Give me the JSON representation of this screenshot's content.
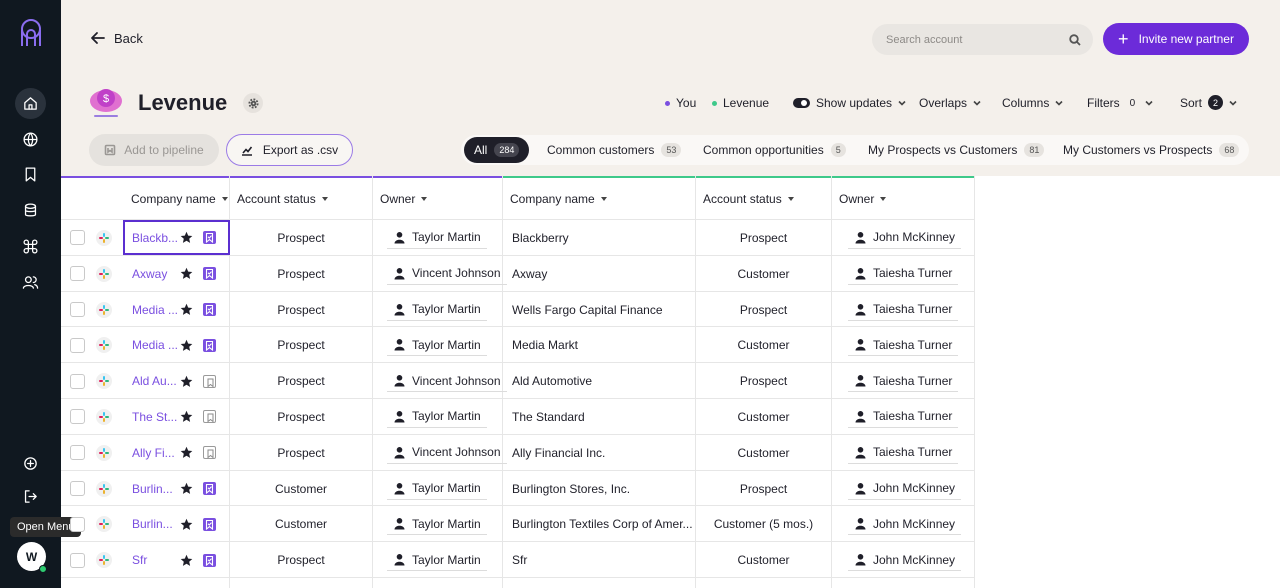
{
  "rail": {
    "tooltip": "Open Menu",
    "avatar_initial": "W"
  },
  "header": {
    "back_label": "Back",
    "search_placeholder": "Search account",
    "invite_label": "Invite new partner",
    "title": "Levenue",
    "legend": [
      {
        "label": "You",
        "color": "#7a4fe0"
      },
      {
        "label": "Levenue",
        "color": "#3ec98a"
      }
    ],
    "controls": {
      "show_updates": "Show updates",
      "overlaps": "Overlaps",
      "columns": "Columns",
      "filters": "Filters",
      "filters_count": "0",
      "sort": "Sort",
      "sort_count": "2"
    },
    "add_pipeline_label": "Add to pipeline",
    "export_label": "Export as .csv",
    "tabs": [
      {
        "label": "All",
        "count": "284"
      },
      {
        "label": "Common customers",
        "count": "53"
      },
      {
        "label": "Common opportunities",
        "count": "5"
      },
      {
        "label": "My Prospects vs Customers",
        "count": "81"
      },
      {
        "label": "My Customers vs Prospects",
        "count": "68"
      }
    ]
  },
  "table": {
    "headers": {
      "company": "Company name",
      "status": "Account status",
      "owner": "Owner",
      "p_company": "Company name",
      "p_status": "Account status",
      "p_owner": "Owner"
    },
    "rows": [
      {
        "company": "Blackb...",
        "bookmarked": true,
        "status": "Prospect",
        "owner": "Taylor Martin",
        "p_company": "Blackberry",
        "p_status": "Prospect",
        "p_owner": "John McKinney"
      },
      {
        "company": "Axway",
        "bookmarked": true,
        "status": "Prospect",
        "owner": "Vincent Johnson",
        "p_company": "Axway",
        "p_status": "Customer",
        "p_owner": "Taiesha Turner"
      },
      {
        "company": "Media ...",
        "bookmarked": true,
        "status": "Prospect",
        "owner": "Taylor Martin",
        "p_company": "Wells Fargo Capital Finance",
        "p_status": "Prospect",
        "p_owner": "Taiesha Turner"
      },
      {
        "company": "Media ...",
        "bookmarked": true,
        "status": "Prospect",
        "owner": "Taylor Martin",
        "p_company": "Media Markt",
        "p_status": "Customer",
        "p_owner": "Taiesha Turner"
      },
      {
        "company": "Ald Au...",
        "bookmarked": false,
        "status": "Prospect",
        "owner": "Vincent Johnson",
        "p_company": "Ald Automotive",
        "p_status": "Prospect",
        "p_owner": "Taiesha Turner"
      },
      {
        "company": "The St...",
        "bookmarked": false,
        "status": "Prospect",
        "owner": "Taylor Martin",
        "p_company": "The Standard",
        "p_status": "Customer",
        "p_owner": "Taiesha Turner"
      },
      {
        "company": "Ally Fi...",
        "bookmarked": false,
        "status": "Prospect",
        "owner": "Vincent Johnson",
        "p_company": "Ally Financial Inc.",
        "p_status": "Customer",
        "p_owner": "Taiesha Turner"
      },
      {
        "company": "Burlin...",
        "bookmarked": true,
        "status": "Customer",
        "owner": "Taylor Martin",
        "p_company": "Burlington Stores, Inc.",
        "p_status": "Prospect",
        "p_owner": "John McKinney"
      },
      {
        "company": "Burlin...",
        "bookmarked": true,
        "status": "Customer",
        "owner": "Taylor Martin",
        "p_company": "Burlington Textiles Corp of Amer...",
        "p_status": "Customer (5 mos.)",
        "p_owner": "John McKinney"
      },
      {
        "company": "Sfr",
        "bookmarked": true,
        "status": "Prospect",
        "owner": "Taylor Martin",
        "p_company": "Sfr",
        "p_status": "Customer",
        "p_owner": "John McKinney"
      }
    ]
  },
  "colors": {
    "accent": "#6c2bd9",
    "you": "#7a4fe0",
    "partner": "#3ec98a"
  }
}
